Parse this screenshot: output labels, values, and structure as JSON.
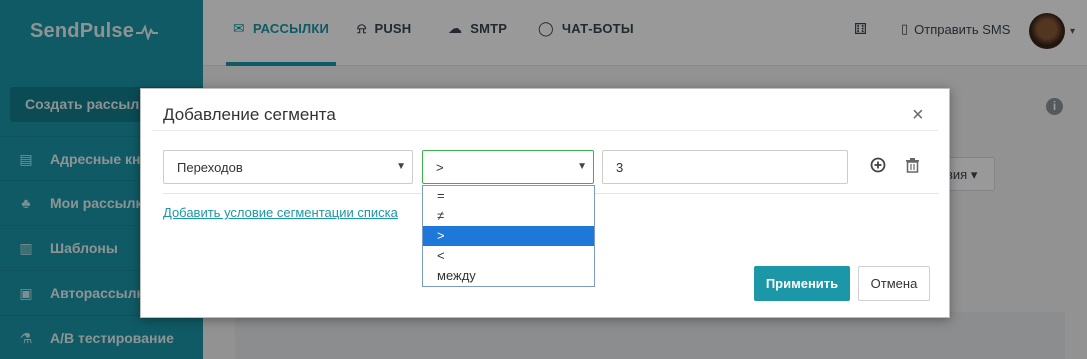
{
  "app": {
    "logo": "SendPulse"
  },
  "topnav": {
    "items": [
      {
        "label": "РАССЫЛКИ",
        "icon": "mail-icon",
        "active": true
      },
      {
        "label": "PUSH",
        "icon": "bell-icon",
        "active": false
      },
      {
        "label": "SMTP",
        "icon": "cloud-icon",
        "active": false
      },
      {
        "label": "ЧАТ-БОТЫ",
        "icon": "chat-icon",
        "active": false
      }
    ],
    "sms_label": "Отправить SMS"
  },
  "sidebar": {
    "create_button": "Создать рассылку",
    "items": [
      {
        "label": "Адресные книги",
        "icon": "book-icon"
      },
      {
        "label": "Мои рассылки",
        "icon": "campaigns-icon"
      },
      {
        "label": "Шаблоны",
        "icon": "templates-icon"
      },
      {
        "label": "Авторассылки",
        "icon": "automation-icon"
      },
      {
        "label": "A/B тестирование",
        "icon": "ab-test-icon"
      }
    ]
  },
  "background": {
    "actions_label": "вия"
  },
  "modal": {
    "title": "Добавление сегмента",
    "condition_field": "Переходов",
    "operator": ">",
    "value": "3",
    "add_condition_link": "Добавить условие сегментации списка",
    "operator_options": [
      "=",
      "≠",
      ">",
      "<",
      "между"
    ],
    "selected_option_index": 2,
    "apply_button": "Применить",
    "cancel_button": "Отмена"
  },
  "colors": {
    "brand": "#1b97a8",
    "selected_option": "#1e78d9",
    "focus_border": "#37b34a"
  }
}
